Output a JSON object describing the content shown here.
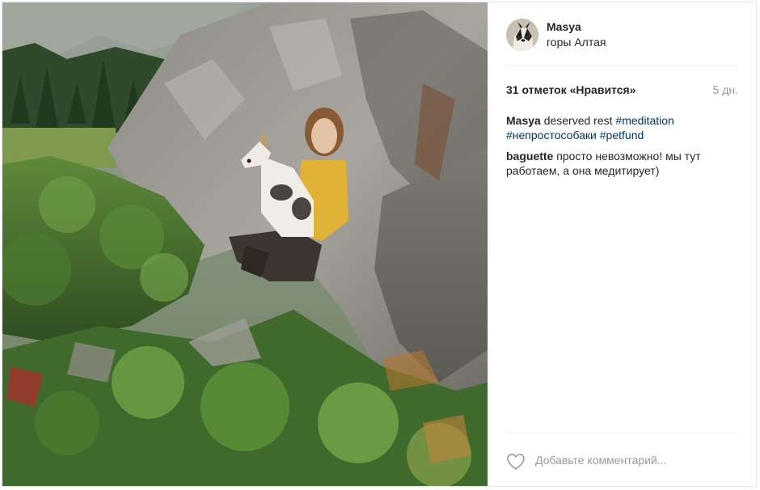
{
  "post": {
    "username": "Masya",
    "location": "горы Алтая",
    "likes": "31 отметок «Нравится»",
    "time_ago": "5 дн.",
    "caption": {
      "user": "Masya",
      "text": "deserved rest",
      "tags": [
        "#meditation",
        "#непростособаки",
        "#petfund"
      ]
    },
    "comments": [
      {
        "user": "baguette",
        "text": "просто невозможно! мы тут работаем, а она медитирует)"
      }
    ],
    "comment_placeholder": "Добавьте комментарий..."
  },
  "colors": {
    "link": "#003569",
    "muted": "#999999",
    "text": "#262626",
    "border": "#efefef"
  },
  "icons": {
    "like": "heart-outline-icon"
  }
}
